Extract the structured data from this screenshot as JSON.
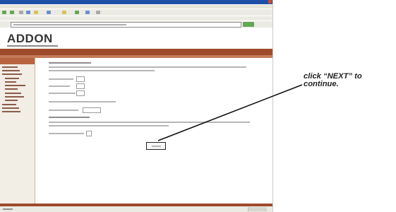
{
  "screenshot": {
    "logo": "ADDON",
    "icons": [
      "back-icon",
      "forward-icon",
      "stop-icon",
      "refresh-icon",
      "home-icon",
      "search-icon",
      "favorites-icon",
      "history-icon",
      "mail-icon",
      "print-icon",
      "go-icon"
    ],
    "colors": {
      "title_bar": "#1f4fa9",
      "banner": "#9e4b2c",
      "banner_accent": "#c47b56",
      "sidebar_header": "#b86440",
      "sidebar_bg": "#f2ede5"
    }
  },
  "annotation": {
    "callout": "click “NEXT” to\ncontinue."
  }
}
